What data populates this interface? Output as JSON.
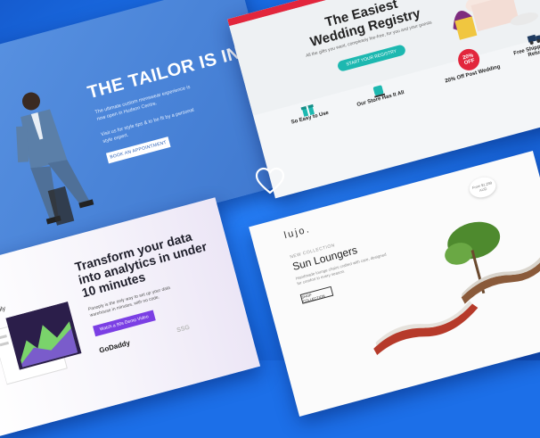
{
  "tailor": {
    "title": "THE TAILOR IS IN",
    "desc1": "The ultimate custom menswear experience is now open in Hudson Centre.",
    "desc2": "Visit us for style tips & to be fit by a personal style expert.",
    "button": "BOOK AN APPOINTMENT"
  },
  "registry": {
    "title": "The Easiest Wedding Registry",
    "subtitle": "All the gifts you want, completely fee-free, for you and your guests",
    "button": "START YOUR REGISTRY",
    "features": [
      "So Easy to Use",
      "Our Store Has It All",
      "20% Off Post Wedding",
      "Free Shipping And Returns"
    ],
    "badge": "20% OFF"
  },
  "analytics": {
    "title": "Transform your data into analytics in under 10 minutes",
    "desc": "Panoply is the only way to set up your data warehouse in minutes, with no code.",
    "button": "Watch a 90s Demo Video",
    "logo": "panoply",
    "partner": "GoDaddy",
    "partner2": "SSG"
  },
  "lujo": {
    "logo": "lujo.",
    "kicker": "NEW COLLECTION",
    "title": "Sun Loungers",
    "desc": "Handmade lounge chairs crafted with care, designed for comfort in every season.",
    "button": "SHOP COLLECTION",
    "tag": "From $1,299 AUD"
  },
  "colors": {
    "background": "#1c6fe8",
    "accent_red": "#e2263c",
    "teal": "#1db8b0",
    "purple": "#7b3fe4"
  },
  "icons": [
    "heart-icon"
  ]
}
